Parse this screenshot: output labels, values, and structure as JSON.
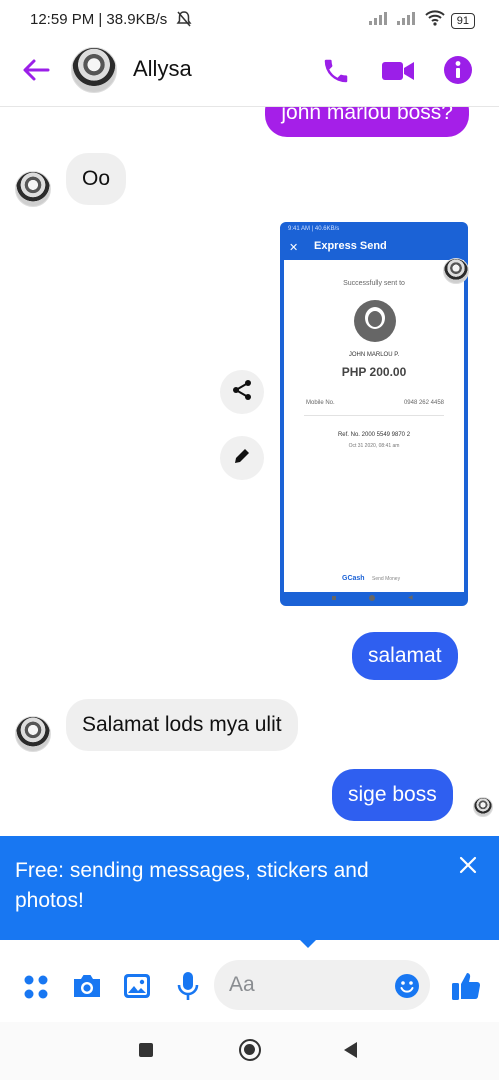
{
  "status_bar": {
    "time_speed": "12:59 PM | 38.9KB/s",
    "battery": "91"
  },
  "header": {
    "contact_name": "Allysa"
  },
  "messages": {
    "partial_out": "john marlou boss?",
    "in_1": "Oo",
    "out_1": "salamat",
    "in_2": "Salamat lods mya ulit",
    "out_2": "sige boss"
  },
  "shared_screenshot": {
    "status": "9:41 AM | 40.6KB/s",
    "title": "Express Send",
    "sent_to": "Successfully sent to",
    "recipient": "JOHN MARLOU P.",
    "amount": "PHP 200.00",
    "mobile_label": "Mobile No.",
    "mobile_value": "0948 262 4458",
    "ref": "Ref. No. 2000 5549 9870 2",
    "date": "Oct 31 2020, 08:41 am",
    "footer_brand": "GCash",
    "footer_text": "Send Money"
  },
  "promo": {
    "text": "Free: sending messages, stickers and photos!"
  },
  "composer": {
    "placeholder": "Aa"
  },
  "colors": {
    "accent": "#9b1fe8",
    "bubble": "#2f5ff0",
    "promo": "#1877f2"
  }
}
